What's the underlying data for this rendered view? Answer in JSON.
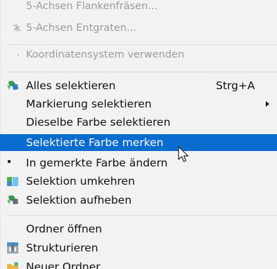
{
  "menu": {
    "items": [
      {
        "id": "fraesen",
        "label": "5-Achsen Flankenfräsen...",
        "icon": "mill-icon",
        "disabled": true
      },
      {
        "id": "entgraten",
        "label": "5-Achsen Entgraten...",
        "icon": "deburr-icon",
        "disabled": true
      },
      {
        "id": "koordinaten",
        "label": "Koordinatensystem verwenden",
        "icon": "dot-icon",
        "disabled": true
      },
      {
        "id": "alles",
        "label": "Alles selektieren",
        "shortcut": "Strg+A",
        "icon": "select-all-icon"
      },
      {
        "id": "markierung",
        "label": "Markierung selektieren",
        "submenu": true
      },
      {
        "id": "dieselbe",
        "label": "Dieselbe Farbe selektieren"
      },
      {
        "id": "merken",
        "label": "Selektierte Farbe merken",
        "highlighted": true
      },
      {
        "id": "aendern",
        "label": "In gemerkte Farbe ändern",
        "icon": "color-change-icon"
      },
      {
        "id": "umkehren",
        "label": "Selektion umkehren",
        "icon": "invert-selection-icon"
      },
      {
        "id": "aufheben",
        "label": "Selektion aufheben",
        "icon": "clear-selection-icon"
      },
      {
        "id": "ordner",
        "label": "Ordner öffnen"
      },
      {
        "id": "strukturieren",
        "label": "Strukturieren",
        "icon": "structure-icon"
      },
      {
        "id": "neuer",
        "label": "Neuer Ordner",
        "icon": "new-folder-icon"
      }
    ]
  },
  "colors": {
    "highlight": "#0a6ccf",
    "menu_background": "#f2f2f2",
    "disabled_text": "#9b9b9b"
  }
}
